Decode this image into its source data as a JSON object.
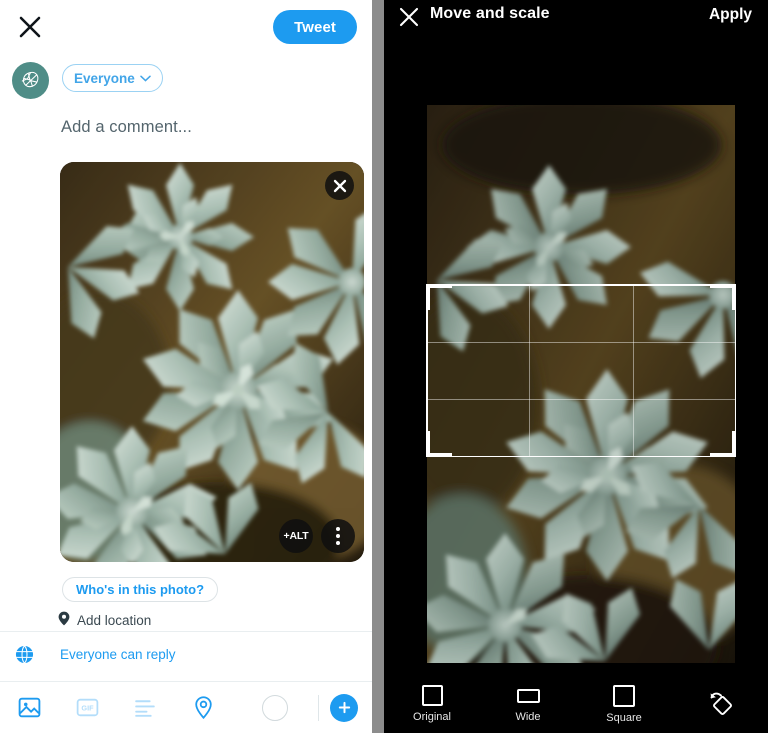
{
  "compose": {
    "close_icon": "close-x-icon",
    "tweet_button": "Tweet",
    "avatar_icon": "leaf-avatar-icon",
    "audience_label": "Everyone",
    "audience_chevron": "chevron-down-icon",
    "comment_placeholder": "Add a comment...",
    "photo": {
      "alt_badge": "+ALT",
      "remove_icon": "close-circle-icon",
      "more_icon": "more-vertical-icon",
      "alt_text": "Close-up photo of pale green succulent rosettes"
    },
    "whos_in_photo": "Who's in this photo?",
    "add_location": "Add location",
    "location_icon": "location-pin-icon",
    "reply_setting": "Everyone can reply",
    "reply_icon": "globe-icon",
    "toolbar": [
      {
        "name": "media-icon",
        "label": "Media",
        "enabled": true
      },
      {
        "name": "gif-icon",
        "label": "GIF",
        "enabled": false
      },
      {
        "name": "poll-icon",
        "label": "Poll",
        "enabled": false
      },
      {
        "name": "location-icon",
        "label": "Location",
        "enabled": true
      },
      {
        "name": "character-count-ring",
        "label": "",
        "enabled": true
      },
      {
        "name": "add-tweet-icon",
        "label": "+",
        "enabled": true
      }
    ],
    "colors": {
      "accent": "#1d9bf0",
      "pill_border": "#9bd2f3",
      "avatar_bg": "#4f8d87",
      "muted_text": "#54656d"
    }
  },
  "cropper": {
    "close_icon": "close-x-icon",
    "title": "Move and scale",
    "apply_button": "Apply",
    "image_alt": "Close-up photo of pale green succulent rosettes",
    "aspect_tools": [
      {
        "name": "original",
        "label": "Original",
        "shape": "square-outline"
      },
      {
        "name": "wide",
        "label": "Wide",
        "shape": "wide-rect-outline"
      },
      {
        "name": "square",
        "label": "Square",
        "shape": "square-outline"
      },
      {
        "name": "rotate",
        "label": "",
        "shape": "rotate-icon"
      }
    ],
    "colors": {
      "background": "#000000",
      "frame": "#ffffff",
      "grid": "rgba(255,255,255,0.45)"
    }
  }
}
